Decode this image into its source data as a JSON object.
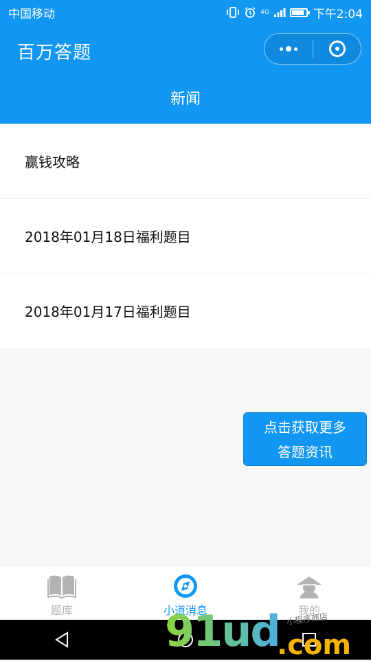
{
  "status_bar": {
    "carrier": "中国移动",
    "network": "4G",
    "time": "下午2:04"
  },
  "header": {
    "app_title": "百万答题",
    "page_title": "新闻"
  },
  "news": [
    {
      "title": "赢钱攻略"
    },
    {
      "title": "2018年01月18日福利题目"
    },
    {
      "title": "2018年01月17日福利题目"
    }
  ],
  "more_button": {
    "line1": "点击获取更多",
    "line2": "答题资讯"
  },
  "tab_bar": {
    "tabs": [
      {
        "label": "题库",
        "icon": "book-icon",
        "active": false
      },
      {
        "label": "小道消息",
        "icon": "compass-icon",
        "active": true
      },
      {
        "label": "我的",
        "icon": "profile-icon",
        "active": false
      }
    ]
  },
  "watermark": {
    "brand": "91ud",
    "suffix": ".com",
    "tagline": "小程序商店"
  },
  "colors": {
    "primary": "#1196f2",
    "inactive_tab": "#b3b3b3"
  }
}
